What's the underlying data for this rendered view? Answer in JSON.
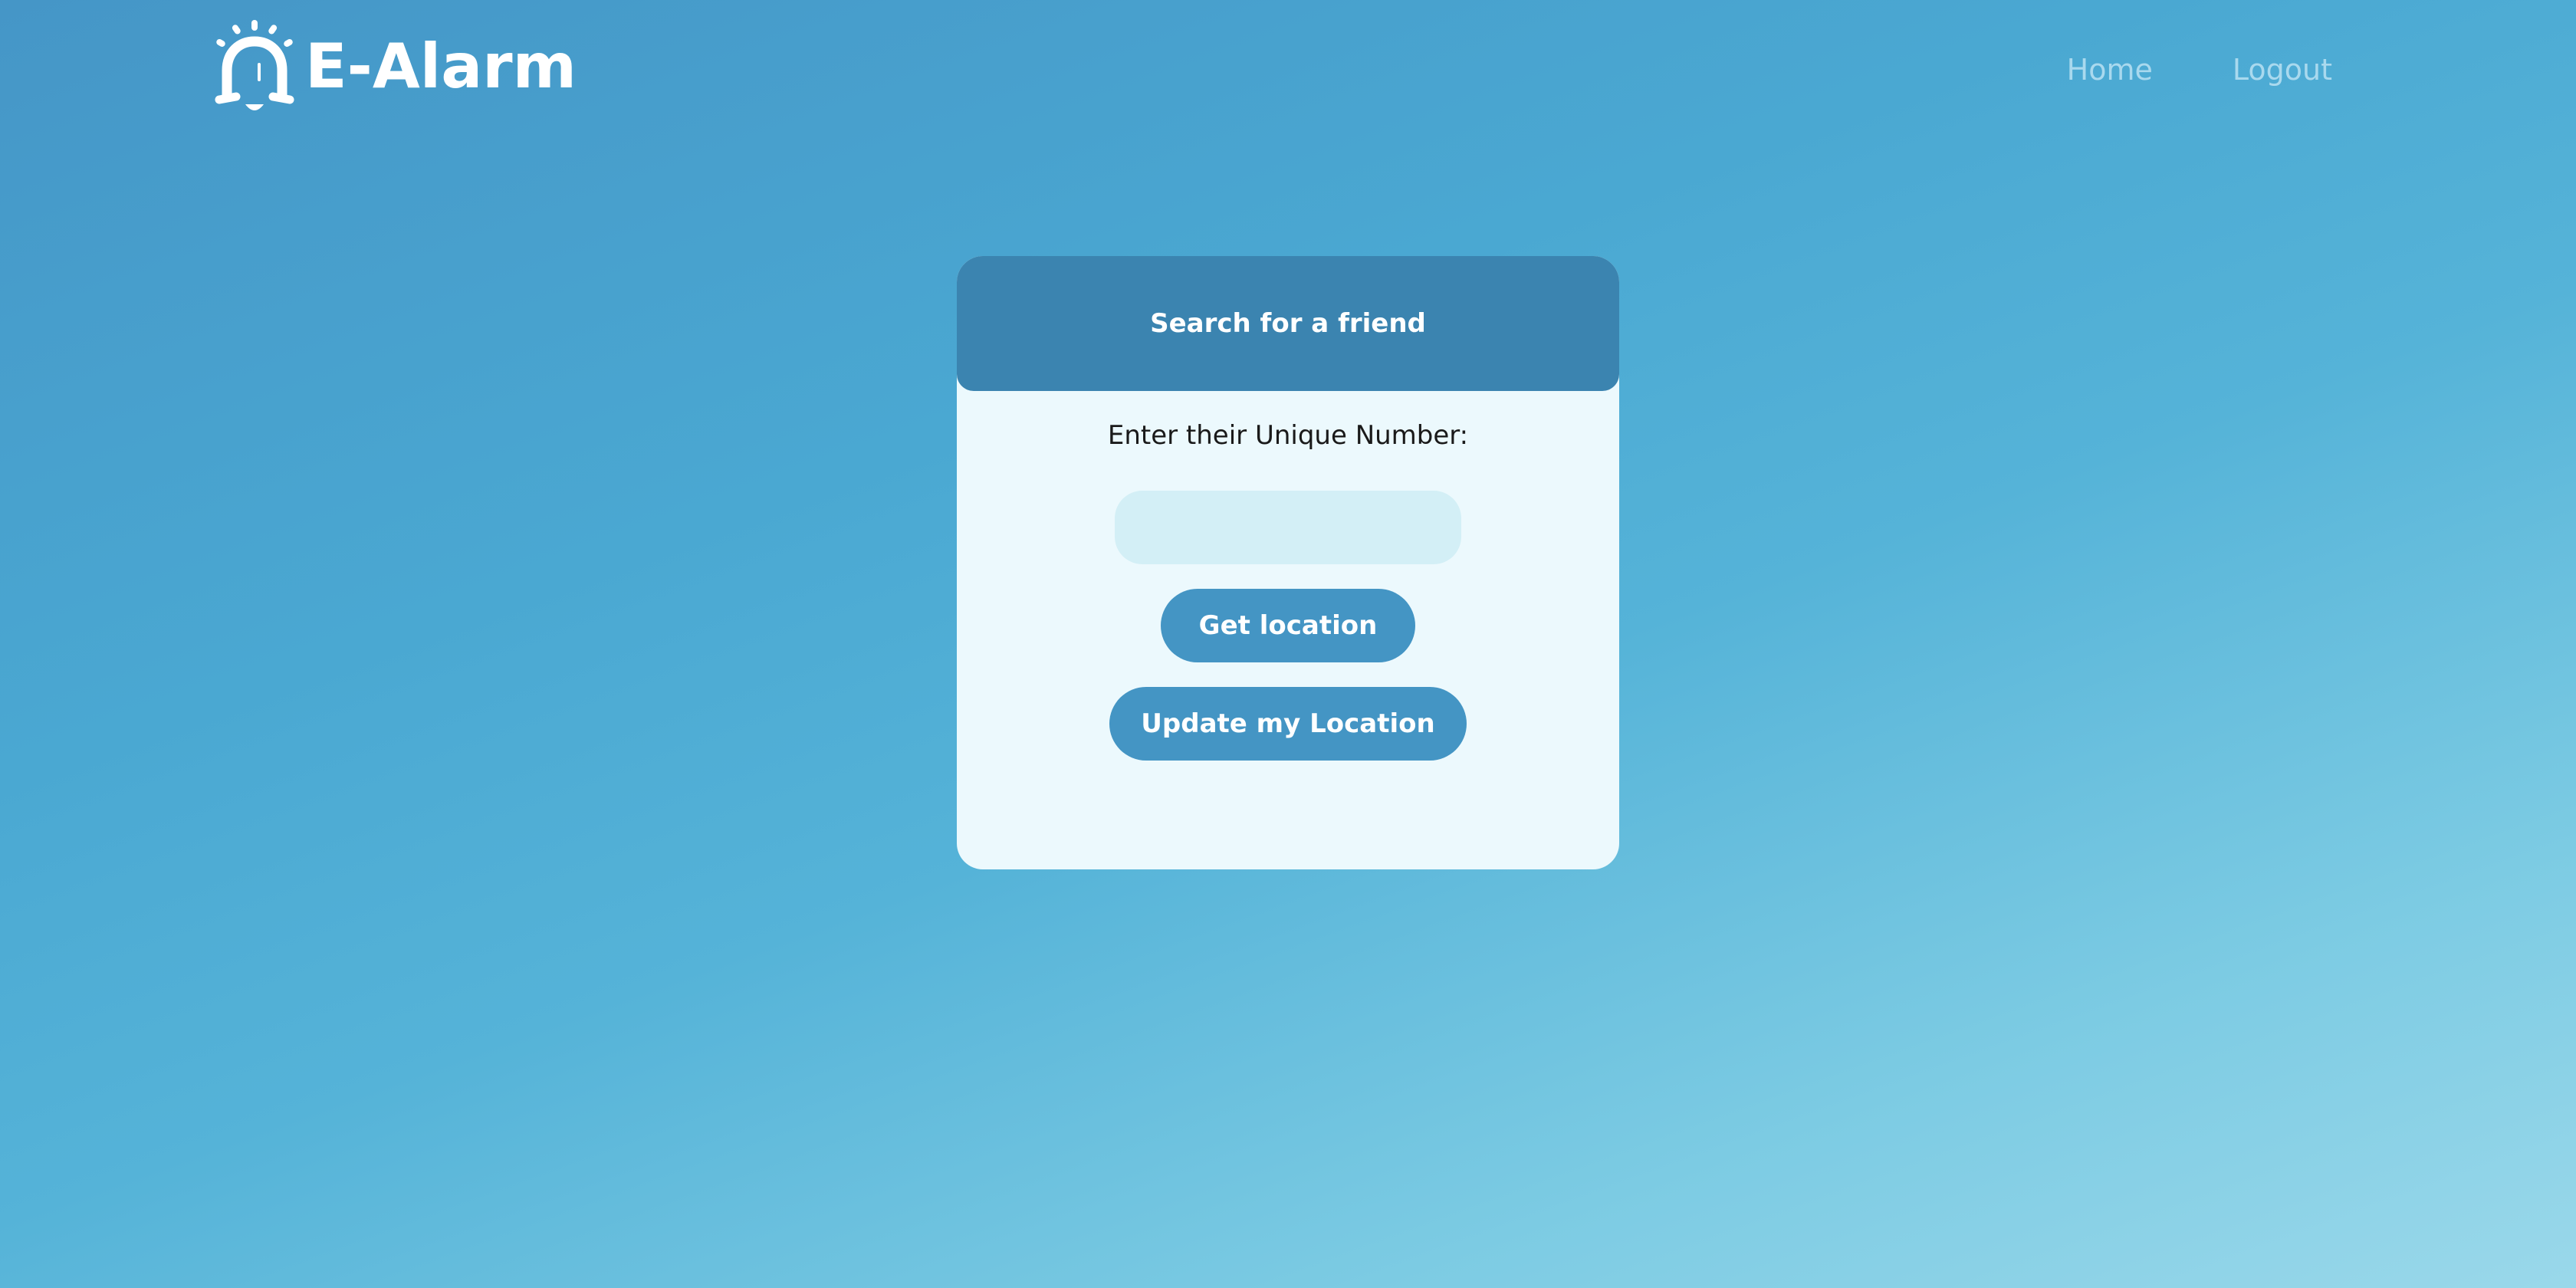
{
  "header": {
    "brand": "E-Alarm",
    "logo_icon": "alarm-bell-icon",
    "nav": {
      "home": "Home",
      "logout": "Logout"
    }
  },
  "card": {
    "title": "Search for a friend",
    "prompt": "Enter their Unique Number:",
    "input": {
      "value": "",
      "placeholder": ""
    },
    "get_location_label": "Get location",
    "update_location_label": "Update my Location"
  },
  "colors": {
    "card_header": "#3b84b0",
    "button": "#4495c4",
    "card_background": "#ecf9fd",
    "input_background": "#d3eff6"
  }
}
